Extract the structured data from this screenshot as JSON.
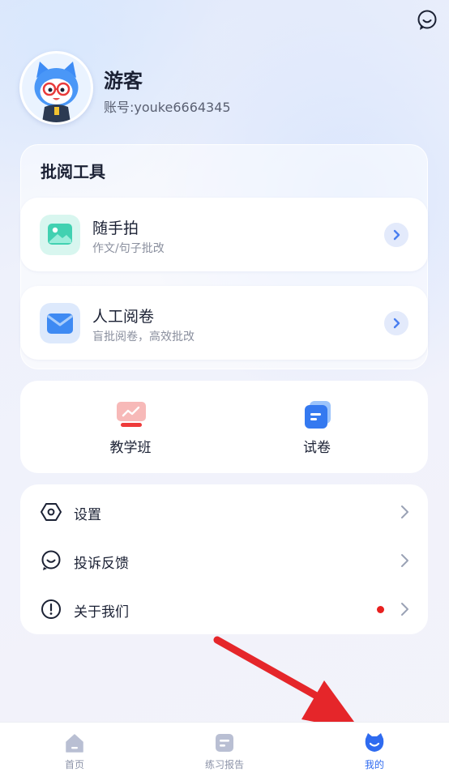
{
  "header": {
    "chat_icon": "chat-smile-icon"
  },
  "profile": {
    "avatar": "cat-mascot-avatar",
    "name": "游客",
    "account": "账号:youke6664345"
  },
  "tools": {
    "title": "批阅工具",
    "items": [
      {
        "name": "随手拍",
        "desc": "作文/句子批改",
        "icon": "photo-icon"
      },
      {
        "name": "人工阅卷",
        "desc": "盲批阅卷，高效批改",
        "icon": "mail-icon"
      }
    ]
  },
  "quick": {
    "items": [
      {
        "label": "教学班",
        "icon": "chart-board-icon"
      },
      {
        "label": "试卷",
        "icon": "paper-icon"
      }
    ]
  },
  "menu": {
    "items": [
      {
        "label": "设置",
        "icon": "settings-hexagon-icon"
      },
      {
        "label": "投诉反馈",
        "icon": "feedback-icon"
      },
      {
        "label": "关于我们",
        "icon": "info-icon",
        "badge": true
      }
    ]
  },
  "tabbar": {
    "items": [
      {
        "label": "首页",
        "icon": "home-icon",
        "active": false
      },
      {
        "label": "练习报告",
        "icon": "report-icon",
        "active": false
      },
      {
        "label": "我的",
        "icon": "profile-cat-icon",
        "active": true
      }
    ]
  },
  "colors": {
    "accent": "#2f6bf0",
    "badge": "#e8201f",
    "annotation_arrow": "#e5262a"
  }
}
